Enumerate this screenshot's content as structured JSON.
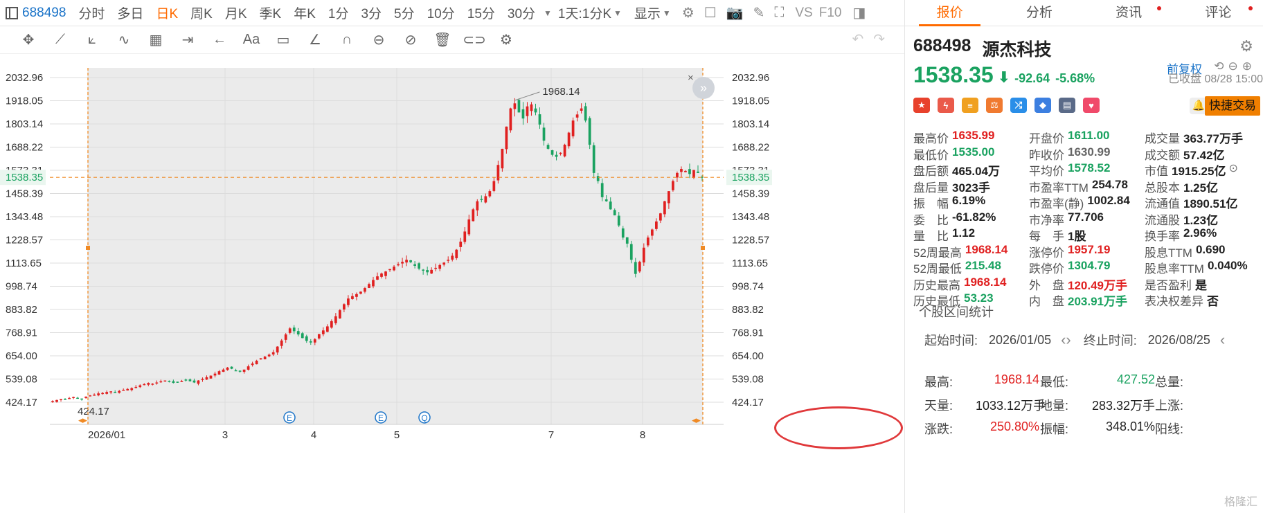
{
  "toolbar": {
    "code": "688498",
    "periods": [
      "分时",
      "多日",
      "日K",
      "周K",
      "月K",
      "季K",
      "年K",
      "1分",
      "3分",
      "5分",
      "10分",
      "15分",
      "30分"
    ],
    "active_period": "日K",
    "range_select": "1天:1分K",
    "display": "显示",
    "vs": "VS",
    "f10": "F10"
  },
  "chart": {
    "adjust_label": "前复权",
    "last_price_label": "1538.35",
    "high_label": "1968.14",
    "low_label": "424.17",
    "event_markers": [
      "E",
      "E",
      "Q"
    ]
  },
  "chart_data": {
    "type": "candlestick",
    "y_ticks": [
      2032.96,
      1918.05,
      1803.14,
      1688.22,
      1573.31,
      1458.39,
      1343.48,
      1228.57,
      1113.65,
      998.74,
      883.82,
      768.91,
      654.0,
      539.08,
      424.17
    ],
    "ylim": [
      424.17,
      2032.96
    ],
    "x_ticks": [
      "2026/01",
      "3",
      "4",
      "5",
      "7",
      "8"
    ],
    "last_price": 1538.35,
    "period_high": 1968.14,
    "period_low": 424.17,
    "closes": [
      430,
      435,
      440,
      438,
      445,
      450,
      446,
      440,
      452,
      458,
      462,
      468,
      470,
      475,
      478,
      474,
      480,
      486,
      490,
      494,
      500,
      508,
      514,
      520,
      516,
      522,
      528,
      532,
      526,
      520,
      524,
      530,
      536,
      528,
      522,
      532,
      540,
      548,
      556,
      566,
      578,
      586,
      596,
      590,
      582,
      576,
      586,
      602,
      616,
      630,
      642,
      650,
      660,
      672,
      700,
      730,
      760,
      790,
      776,
      760,
      742,
      728,
      720,
      736,
      762,
      780,
      800,
      826,
      850,
      880,
      910,
      938,
      950,
      960,
      972,
      990,
      1010,
      1030,
      1048,
      1062,
      1072,
      1084,
      1096,
      1108,
      1120,
      1130,
      1118,
      1100,
      1086,
      1076,
      1068,
      1080,
      1090,
      1104,
      1116,
      1130,
      1150,
      1180,
      1220,
      1270,
      1330,
      1380,
      1420,
      1430,
      1445,
      1470,
      1520,
      1600,
      1680,
      1790,
      1880,
      1905,
      1860,
      1830,
      1890,
      1900,
      1860,
      1800,
      1720,
      1680,
      1650,
      1640,
      1660,
      1700,
      1760,
      1820,
      1850,
      1880,
      1820,
      1700,
      1560,
      1520,
      1440,
      1420,
      1380,
      1350,
      1300,
      1240,
      1210,
      1130,
      1060,
      1120,
      1190,
      1240,
      1280,
      1320,
      1360,
      1420,
      1470,
      1520,
      1560,
      1580,
      1570,
      1555,
      1575,
      1560,
      1538
    ]
  },
  "panel": {
    "tabs": [
      "报价",
      "分析",
      "资讯",
      "评论"
    ],
    "active_tab": "报价",
    "code": "688498",
    "name": "源杰科技",
    "price": "1538.35",
    "change": "-92.64",
    "change_pct": "-5.68%",
    "status": "已收盘 08/28 15:00",
    "quick_trade": "快捷交易",
    "stats": [
      [
        {
          "l": "最高价",
          "v": "1635.99",
          "c": "red"
        },
        {
          "l": "开盘价",
          "v": "1611.00",
          "c": "green"
        },
        {
          "l": "成交量",
          "v": "363.77万手",
          "c": "black"
        }
      ],
      [
        {
          "l": "最低价",
          "v": "1535.00",
          "c": "green"
        },
        {
          "l": "昨收价",
          "v": "1630.99",
          "c": "gray"
        },
        {
          "l": "成交额",
          "v": "57.42亿",
          "c": "black"
        }
      ],
      [
        {
          "l": "盘后额",
          "v": "465.04万",
          "c": "black"
        },
        {
          "l": "平均价",
          "v": "1578.52",
          "c": "green"
        },
        {
          "l": "市值",
          "v": "1915.25亿",
          "c": "black"
        }
      ],
      [
        {
          "l": "盘后量",
          "v": "3023手",
          "c": "black"
        },
        {
          "l": "市盈率TTM",
          "v": "254.78",
          "c": "black"
        },
        {
          "l": "总股本",
          "v": "1.25亿",
          "c": "black"
        }
      ],
      [
        {
          "l": "振　幅",
          "v": "6.19%",
          "c": "black"
        },
        {
          "l": "市盈率(静)",
          "v": "1002.84",
          "c": "black"
        },
        {
          "l": "流通值",
          "v": "1890.51亿",
          "c": "black"
        }
      ],
      [
        {
          "l": "委　比",
          "v": "-61.82%",
          "c": "black"
        },
        {
          "l": "市净率",
          "v": "77.706",
          "c": "black"
        },
        {
          "l": "流通股",
          "v": "1.23亿",
          "c": "black"
        }
      ],
      [
        {
          "l": "量　比",
          "v": "1.12",
          "c": "black"
        },
        {
          "l": "每　手",
          "v": "1股",
          "c": "black"
        },
        {
          "l": "换手率",
          "v": "2.96%",
          "c": "black"
        }
      ],
      [
        {
          "l": "52周最高",
          "v": "1968.14",
          "c": "red"
        },
        {
          "l": "涨停价",
          "v": "1957.19",
          "c": "red"
        },
        {
          "l": "股息TTM",
          "v": "0.690",
          "c": "black"
        }
      ],
      [
        {
          "l": "52周最低",
          "v": "215.48",
          "c": "green"
        },
        {
          "l": "跌停价",
          "v": "1304.79",
          "c": "green"
        },
        {
          "l": "股息率TTM",
          "v": "0.040%",
          "c": "black"
        }
      ],
      [
        {
          "l": "历史最高",
          "v": "1968.14",
          "c": "red"
        },
        {
          "l": "外　盘",
          "v": "120.49万手",
          "c": "red"
        },
        {
          "l": "是否盈利",
          "v": "是",
          "c": "black"
        }
      ],
      [
        {
          "l": "历史最低",
          "v": "53.23",
          "c": "green"
        },
        {
          "l": "内　盘",
          "v": "203.91万手",
          "c": "green"
        },
        {
          "l": "表决权差异",
          "v": "否",
          "c": "black"
        }
      ]
    ],
    "interval_title": "个股区间统计",
    "start_label": "起始时间:",
    "start_value": "2026/01/05",
    "end_label": "终止时间:",
    "end_value": "2026/08/25",
    "range_stats": [
      [
        {
          "l": "最高:",
          "v": "1968.14",
          "c": "red"
        },
        {
          "l": "最低:",
          "v": "427.52",
          "c": "green"
        },
        {
          "l": "总量:",
          "v": "",
          "c": "black"
        }
      ],
      [
        {
          "l": "天量:",
          "v": "1033.12万手",
          "c": "black"
        },
        {
          "l": "地量:",
          "v": "283.32万手",
          "c": "black"
        },
        {
          "l": "上涨:",
          "v": "",
          "c": "black"
        }
      ],
      [
        {
          "l": "涨跌:",
          "v": "250.80%",
          "c": "red"
        },
        {
          "l": "振幅:",
          "v": "348.01%",
          "c": "black"
        },
        {
          "l": "阳线:",
          "v": "",
          "c": "black"
        }
      ]
    ],
    "watermark": "格隆汇"
  },
  "colors": {
    "up": "#e02020",
    "down": "#1aa260",
    "accent": "#ff6a00",
    "link": "#1a73c8"
  }
}
